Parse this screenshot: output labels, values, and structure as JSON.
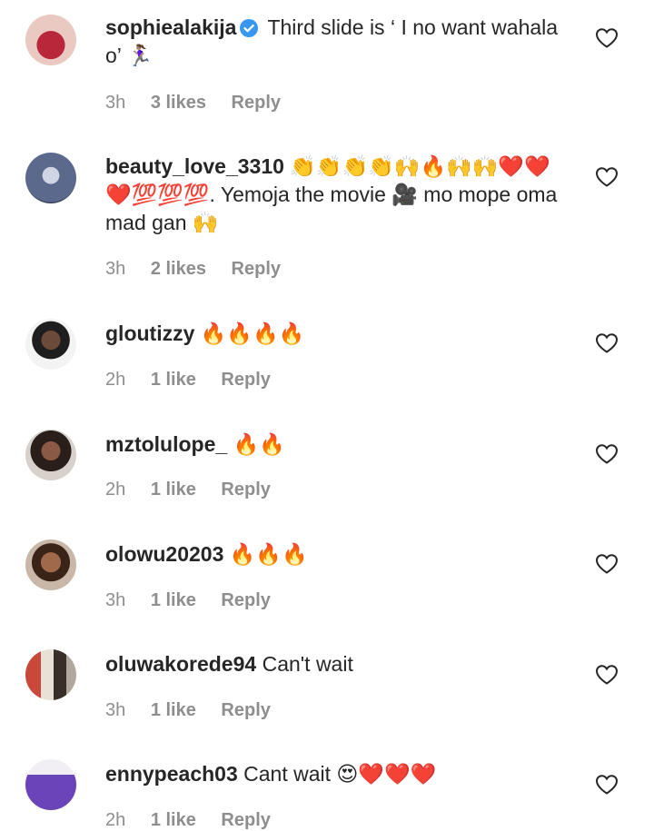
{
  "comments": [
    {
      "username": "sophiealakija",
      "verified": true,
      "text": "Third slide is ‘ I no want wahala o’ 🏃🏽‍♀️",
      "time": "3h",
      "likes": "3 likes",
      "reply": "Reply",
      "avatar_color": "#b8273a"
    },
    {
      "username": "beauty_love_3310",
      "verified": false,
      "text": "👏👏👏👏🙌🔥🙌🙌❤️❤️❤️💯💯💯. Yemoja the movie 🎥 mo mope oma mad gan 🙌",
      "time": "3h",
      "likes": "2 likes",
      "reply": "Reply",
      "avatar_color": "#5b6a8c"
    },
    {
      "username": "gloutizzy",
      "verified": false,
      "text": "🔥🔥🔥🔥",
      "time": "2h",
      "likes": "1 like",
      "reply": "Reply",
      "avatar_color": "#2a2a2a"
    },
    {
      "username": "mztolulope_",
      "verified": false,
      "text": "🔥🔥",
      "time": "2h",
      "likes": "1 like",
      "reply": "Reply",
      "avatar_color": "#5c3b2e"
    },
    {
      "username": "olowu20203",
      "verified": false,
      "text": "🔥🔥🔥",
      "time": "3h",
      "likes": "1 like",
      "reply": "Reply",
      "avatar_color": "#8a5a3c"
    },
    {
      "username": "oluwakorede94",
      "verified": false,
      "text": "Can't wait",
      "time": "3h",
      "likes": "1 like",
      "reply": "Reply",
      "avatar_color": "#a04a3a"
    },
    {
      "username": "ennypeach03",
      "verified": false,
      "text": "Cant wait 😍❤️❤️❤️",
      "time": "2h",
      "likes": "1 like",
      "reply": "Reply",
      "avatar_color": "#5a3c8c"
    }
  ]
}
